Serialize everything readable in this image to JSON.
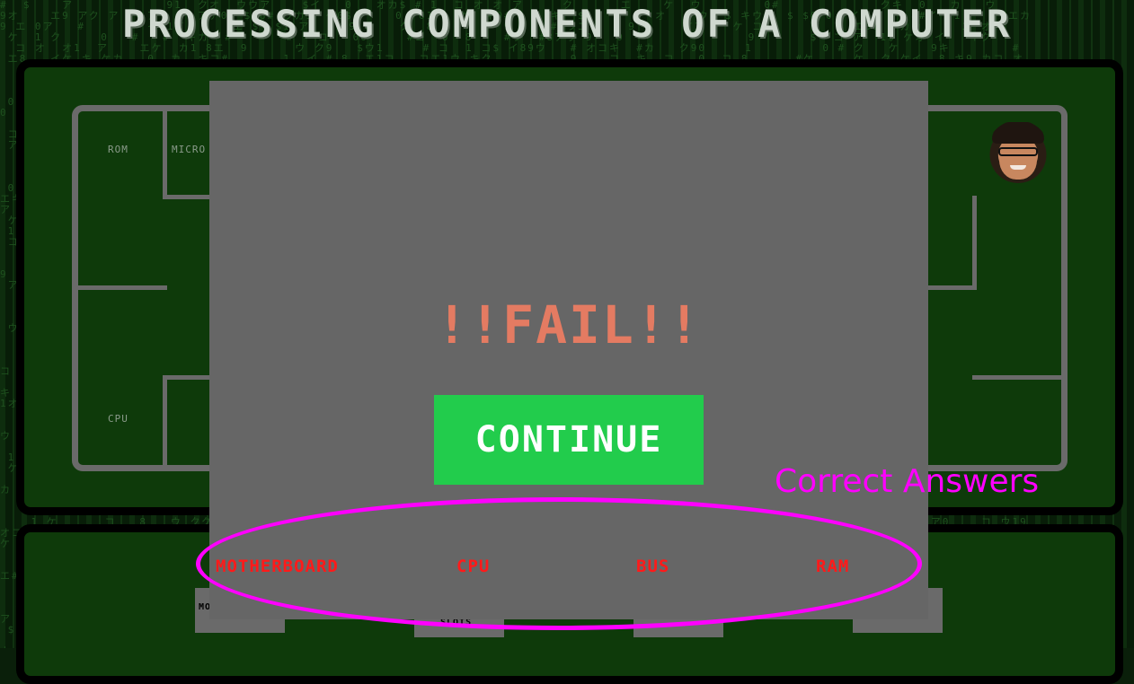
{
  "page": {
    "title": "PROCESSING COMPONENTS OF A COMPUTER"
  },
  "board": {
    "labels": {
      "rom": "ROM",
      "micro": "MICRO",
      "cpu": "CPU"
    },
    "slots": {
      "slot_a_label": "MO",
      "slot_b_label": "SLOTS"
    }
  },
  "modal": {
    "result": "!!FAIL!!",
    "continue_label": "CONTINUE",
    "answers": [
      "MOTHERBOARD",
      "CPU",
      "BUS",
      "RAM"
    ]
  },
  "annotation": {
    "text": "Correct Answers",
    "color": "#ff00ff"
  },
  "colors": {
    "fail": "#e47b62",
    "continue_bg": "#22cc4c",
    "answer_text": "#ff1a1a",
    "modal_bg": "#666666"
  },
  "icons": {
    "avatar": "player-avatar"
  }
}
